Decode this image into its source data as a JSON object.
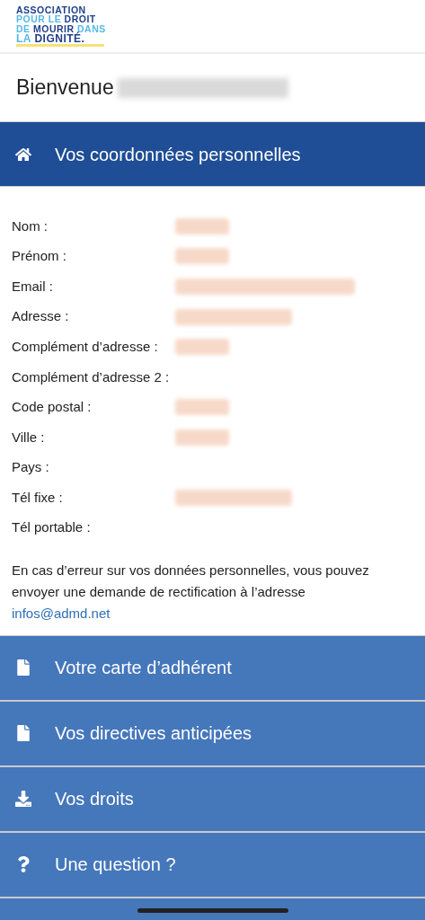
{
  "logo": {
    "lines": [
      [
        {
          "text": "ASSOCIATION",
          "color": "#1f3f8a"
        }
      ],
      [
        {
          "text": "POUR LE ",
          "color": "#55b8e6"
        },
        {
          "text": "DROIT",
          "color": "#1f3f8a"
        }
      ],
      [
        {
          "text": "DE ",
          "color": "#55b8e6"
        },
        {
          "text": "MOURIR ",
          "color": "#1f3f8a"
        },
        {
          "text": "DANS",
          "color": "#55b8e6"
        }
      ],
      [
        {
          "text": "LA ",
          "color": "#55b8e6"
        },
        {
          "text": "DIGNITÉ.",
          "color": "#1f3f8a"
        }
      ]
    ]
  },
  "welcome": {
    "text": "Bienvenue",
    "name_redacted": true
  },
  "section": {
    "kind": "home",
    "title": "Vos coordonnées personnelles",
    "expanded": true
  },
  "fields": [
    {
      "label": "Nom :",
      "redacted": true
    },
    {
      "label": "Prénom :",
      "redacted": true
    },
    {
      "label": "Email :",
      "redacted": true
    },
    {
      "label": "Adresse :",
      "redacted": true
    },
    {
      "label": "Complément d’adresse :",
      "redacted": true
    },
    {
      "label": "Complément d’adresse 2 :",
      "redacted": false
    },
    {
      "label": "Code postal :",
      "redacted": true
    },
    {
      "label": "Ville :",
      "redacted": true
    },
    {
      "label": "Pays :",
      "redacted": false
    },
    {
      "label": "Tél fixe :",
      "redacted": true
    },
    {
      "label": "Tél portable :",
      "redacted": false
    }
  ],
  "notice": {
    "text": "En cas d’erreur sur vos données personnelles, vous pouvez envoyer une demande de rectification à l’adresse",
    "link": "infos@admd.net"
  },
  "menu": [
    {
      "kind": "file",
      "label": "Votre carte d’adhérent"
    },
    {
      "kind": "file",
      "label": "Vos directives anticipées"
    },
    {
      "kind": "download",
      "label": "Vos droits"
    },
    {
      "kind": "question",
      "label": "Une question ?"
    }
  ]
}
